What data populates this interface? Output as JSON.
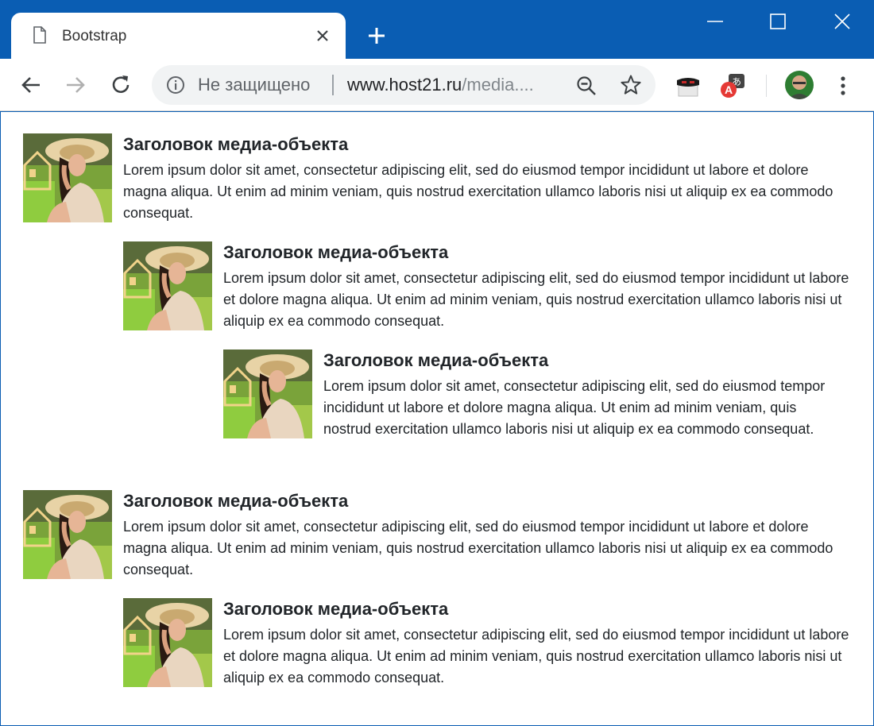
{
  "tab": {
    "title": "Bootstrap"
  },
  "toolbar": {
    "security_text": "Не защищено",
    "url_host": "www.host21.ru",
    "url_path": "/media...."
  },
  "media": {
    "title": "Заголовок медиа-объекта",
    "text": "Lorem ipsum dolor sit amet, consectetur adipiscing elit, sed do eiusmod tempor incididunt ut labore et dolore magna aliqua. Ut enim ad minim veniam, quis nostrud exercitation ullamco laboris nisi ut aliquip ex ea commodo consequat."
  },
  "colors": {
    "titlebar": "#0a5db3",
    "text": "#212529"
  }
}
